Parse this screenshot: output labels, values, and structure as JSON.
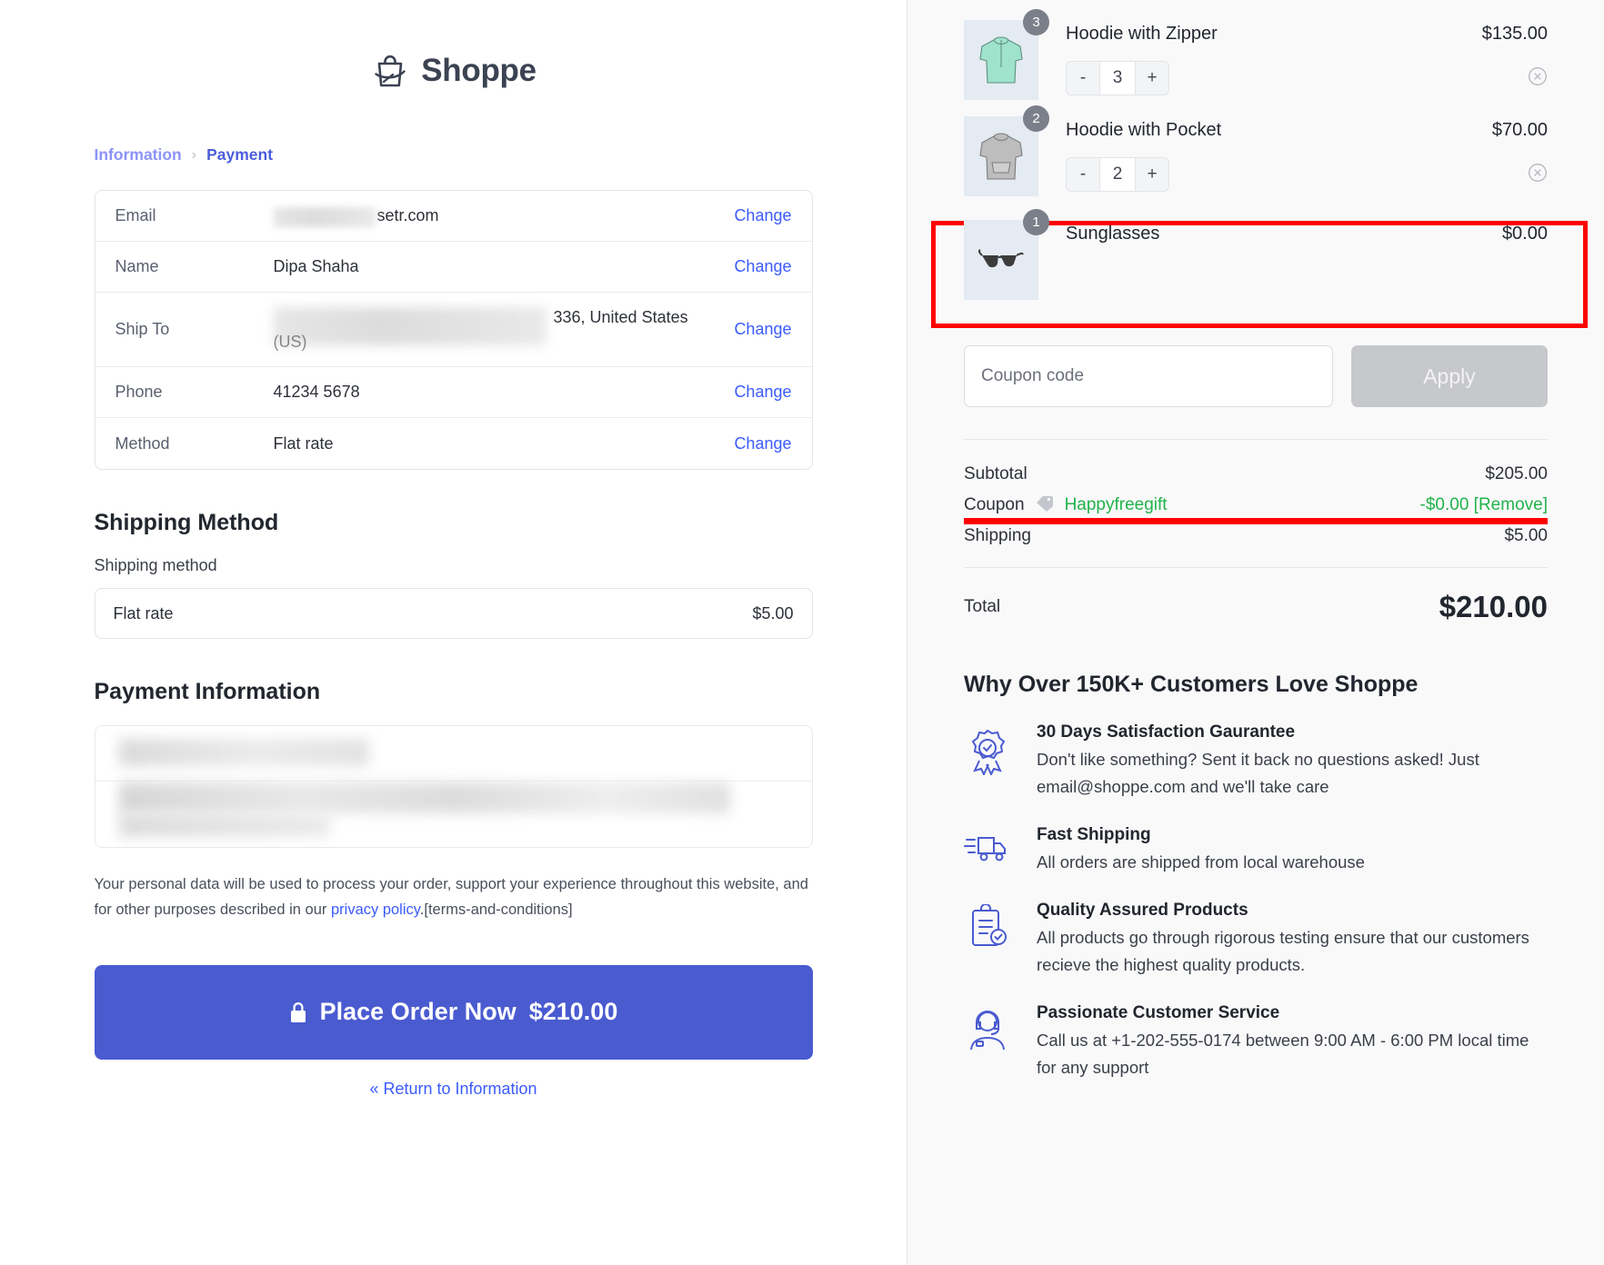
{
  "brand": {
    "name": "Shoppe",
    "logo_icon": "shopping-bag-icon",
    "accent": "#4a5bd0"
  },
  "breadcrumb": {
    "previous": "Information",
    "separator": "›",
    "current": "Payment"
  },
  "info_card": {
    "rows": [
      {
        "label": "Email",
        "value": "setr.com",
        "redacted": true,
        "action": "Change"
      },
      {
        "label": "Name",
        "value": "Dipa Shaha",
        "redacted": false,
        "action": "Change"
      },
      {
        "label": "Ship To",
        "value": "336, United States (US)",
        "redacted": true,
        "action": "Change"
      },
      {
        "label": "Phone",
        "value": "41234 5678",
        "redacted": false,
        "action": "Change"
      },
      {
        "label": "Method",
        "value": "Flat rate",
        "redacted": false,
        "action": "Change"
      }
    ]
  },
  "shipping_section": {
    "title": "Shipping Method",
    "field_label": "Shipping method",
    "option_name": "Flat rate",
    "option_price": "$5.00"
  },
  "payment_section": {
    "title": "Payment Information",
    "redacted": true
  },
  "legal": {
    "text_before": "Your personal data will be used to process your order, support your experience throughout this website, and for other purposes described in our ",
    "link": "privacy policy",
    "text_after": ".[terms-and-conditions]"
  },
  "place_order": {
    "icon": "lock-icon",
    "label": "Place Order Now",
    "amount": "$210.00"
  },
  "return_link": "« Return to Information",
  "cart": {
    "items": [
      {
        "name": "Hoodie with Zipper",
        "price": "$135.00",
        "badge": "3",
        "qty": "3",
        "minus": "-",
        "plus": "+",
        "thumb_icon": "hoodie-zipper-thumb",
        "remove_icon": "remove-circle-icon",
        "highlighted": false
      },
      {
        "name": "Hoodie with Pocket",
        "price": "$70.00",
        "badge": "2",
        "qty": "2",
        "minus": "-",
        "plus": "+",
        "thumb_icon": "hoodie-pocket-thumb",
        "remove_icon": "remove-circle-icon",
        "highlighted": false
      },
      {
        "name": "Sunglasses",
        "price": "$0.00",
        "badge": "1",
        "qty": null,
        "thumb_icon": "sunglasses-thumb",
        "remove_icon": null,
        "highlighted": true
      }
    ]
  },
  "coupon": {
    "placeholder": "Coupon code",
    "value": "",
    "apply_label": "Apply"
  },
  "totals": {
    "subtotal_label": "Subtotal",
    "subtotal_value": "$205.00",
    "coupon_label": "Coupon",
    "coupon_icon": "price-tag-icon",
    "coupon_code": "Happyfreegift",
    "coupon_value": "-$0.00 [Remove]",
    "shipping_label": "Shipping",
    "shipping_value": "$5.00",
    "total_label": "Total",
    "total_value": "$210.00",
    "coupon_color": "#21b34a"
  },
  "why": {
    "title": "Why Over 150K+ Customers Love Shoppe",
    "features": [
      {
        "icon": "badge-check-icon",
        "head": "30 Days Satisfaction Gaurantee",
        "body": "Don't like something? Sent it back no questions asked! Just email@shoppe.com and we'll take care"
      },
      {
        "icon": "delivery-truck-icon",
        "head": "Fast Shipping",
        "body": "All orders are shipped from local warehouse"
      },
      {
        "icon": "clipboard-check-icon",
        "head": "Quality Assured Products",
        "body": "All products go through rigorous testing ensure that our customers recieve the highest quality products."
      },
      {
        "icon": "headset-agent-icon",
        "head": "Passionate Customer Service",
        "body": "Call us at +1-202-555-0174 between 9:00 AM - 6:00 PM local time for any support"
      }
    ]
  },
  "annotations": {
    "highlight_color": "#ff0000"
  }
}
